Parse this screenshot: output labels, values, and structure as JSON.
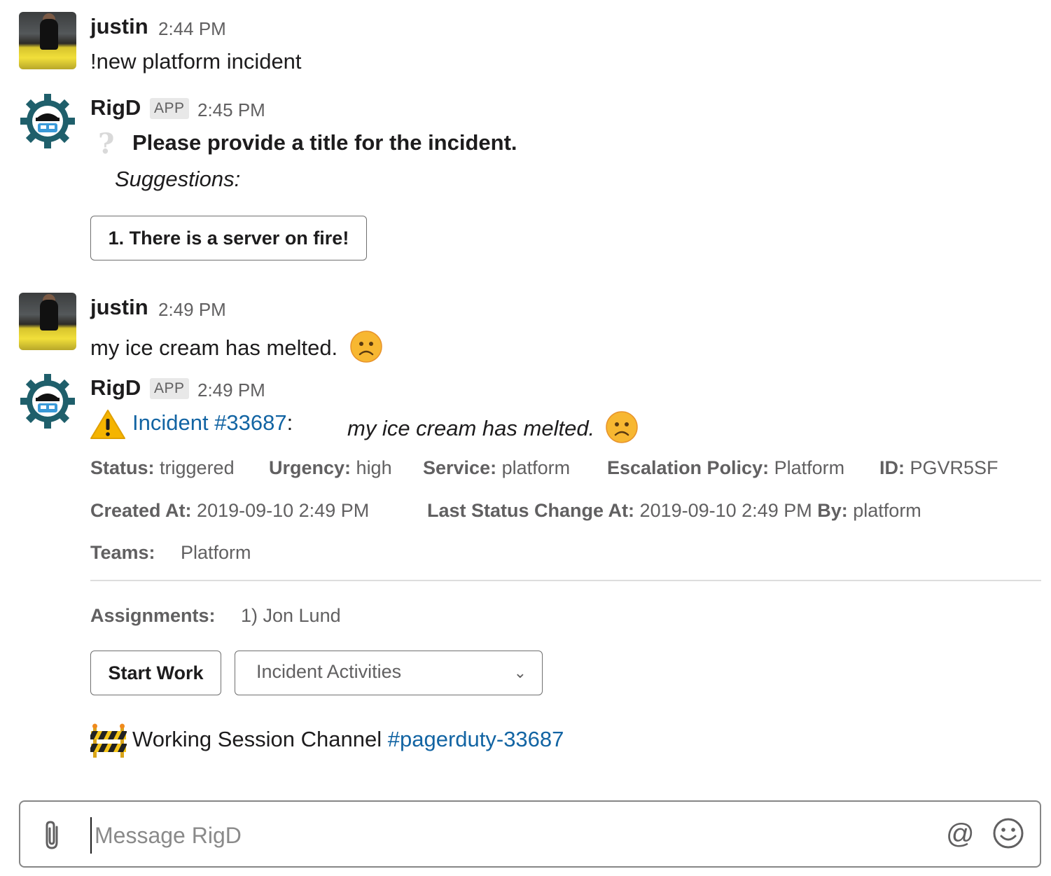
{
  "messages": [
    {
      "author": "justin",
      "time": "2:44 PM",
      "text": "!new platform incident"
    },
    {
      "author": "RigD",
      "badge": "APP",
      "time": "2:45 PM",
      "prompt": "Please provide a title for the incident.",
      "suggestions_label": "Suggestions:",
      "suggestion_button": "1. There is a server on fire!"
    },
    {
      "author": "justin",
      "time": "2:49 PM",
      "text": "my ice cream has melted."
    },
    {
      "author": "RigD",
      "badge": "APP",
      "time": "2:49 PM",
      "incident_link": "Incident #33687",
      "incident_colon": ":",
      "incident_title": "my ice cream has melted.",
      "fields": {
        "status_label": "Status:",
        "status_value": "triggered",
        "urgency_label": "Urgency:",
        "urgency_value": "high",
        "service_label": "Service:",
        "service_value": "platform",
        "escalation_label": "Escalation Policy:",
        "escalation_value": "Platform",
        "id_label": "ID:",
        "id_value": "PGVR5SF",
        "created_label": "Created At:",
        "created_value": "2019-09-10 2:49 PM",
        "last_change_label": "Last Status Change At:",
        "last_change_value": "2019-09-10 2:49 PM",
        "by_label": "By:",
        "by_value": "platform",
        "teams_label": "Teams:",
        "teams_value": "Platform",
        "assignments_label": "Assignments:",
        "assignments_value": "1) Jon Lund"
      },
      "start_work_button": "Start Work",
      "activities_select": "Incident Activities",
      "working_session_text": "Working Session Channel",
      "working_session_channel": "#pagerduty-33687"
    }
  ],
  "composer": {
    "placeholder": "Message RigD"
  },
  "icons": {
    "attach": "paperclip-icon",
    "mention": "at-icon",
    "emoji": "emoji-icon",
    "question": "question-mark-icon",
    "warning": "warning-icon",
    "frown": "frowning-face-icon",
    "construction": "construction-icon"
  },
  "colors": {
    "link": "#1264a3",
    "muted": "#616061",
    "text": "#1d1c1d",
    "warning": "#f5b400",
    "emoji_face": "#f7b731"
  }
}
